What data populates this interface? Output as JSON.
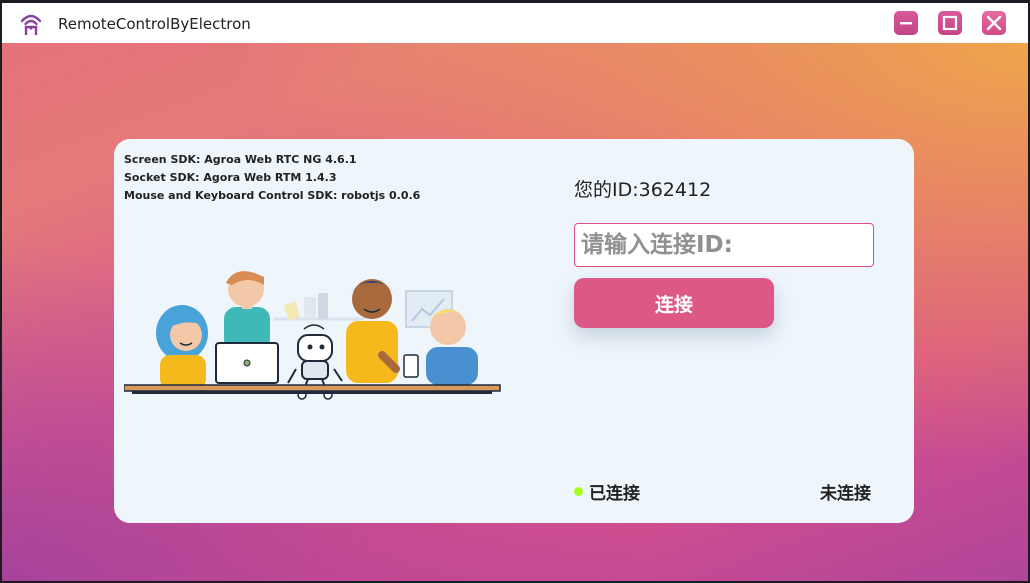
{
  "window": {
    "title": "RemoteControlByElectron",
    "icon": "wifi-signal-icon",
    "controls": [
      "minimize-icon",
      "maximize-icon",
      "close-icon"
    ]
  },
  "sdk_info": {
    "screen": "Screen SDK: Agroa Web RTC NG 4.6.1",
    "socket": "Socket SDK: Agora Web RTM 1.4.3",
    "control": "Mouse and Keyboard Control SDK: robotjs 0.0.6"
  },
  "main": {
    "my_id_label": "您的ID:362412",
    "input_placeholder": "请输入连接ID:",
    "input_value": "",
    "connect_label": "连接"
  },
  "status": {
    "connected_label": "已连接",
    "connected_dot_color": "#aaff22",
    "disconnected_label": "未连接"
  },
  "colors": {
    "accent": "#dd5787",
    "card": "#eef5fb"
  }
}
